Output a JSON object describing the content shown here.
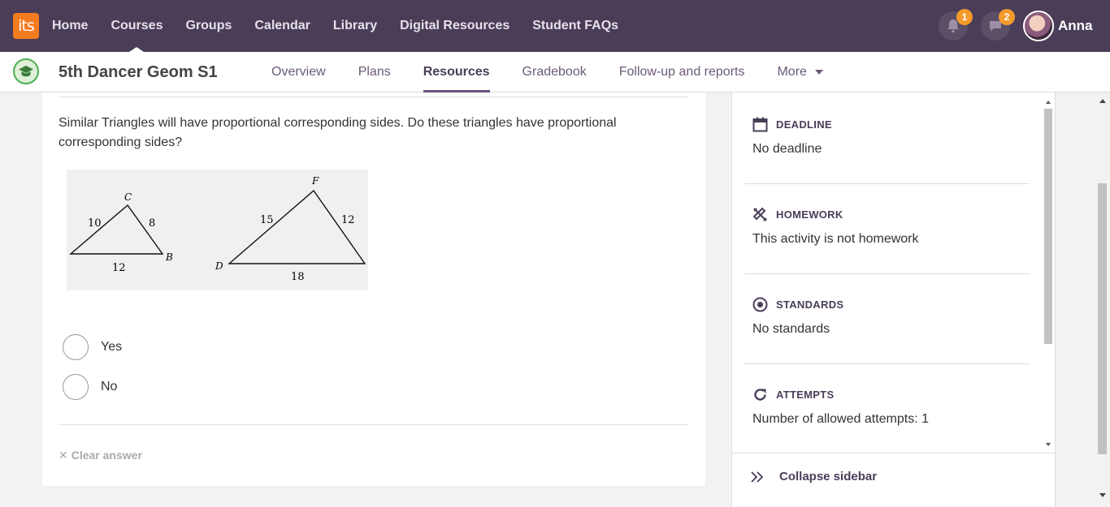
{
  "app": {
    "logo_text": "its"
  },
  "top_nav": {
    "items": [
      "Home",
      "Courses",
      "Groups",
      "Calendar",
      "Library",
      "Digital Resources",
      "Student FAQs"
    ],
    "notifications_count": "1",
    "messages_count": "2",
    "user_name": "Anna"
  },
  "course": {
    "title": "5th Dancer Geom S1",
    "tabs": [
      "Overview",
      "Plans",
      "Resources",
      "Gradebook",
      "Follow-up and reports",
      "More"
    ],
    "active_tab": "Resources"
  },
  "question": {
    "text": "Similar Triangles will have proportional corresponding sides.  Do these triangles have proportional corresponding sides?",
    "figure": {
      "triangle1": {
        "vertex_c": "C",
        "vertex_b": "B",
        "side_left": "10",
        "side_right": "8",
        "side_bottom": "12"
      },
      "triangle2": {
        "vertex_f": "F",
        "vertex_d": "D",
        "side_left": "15",
        "side_right": "12",
        "side_bottom": "18"
      }
    },
    "options": [
      "Yes",
      "No"
    ],
    "clear_label": "Clear answer"
  },
  "sidebar": {
    "deadline": {
      "title": "DEADLINE",
      "value": "No deadline"
    },
    "homework": {
      "title": "HOMEWORK",
      "value": "This activity is not homework"
    },
    "standards": {
      "title": "STANDARDS",
      "value": "No standards"
    },
    "attempts": {
      "title": "ATTEMPTS",
      "value": "Number of allowed attempts: 1"
    },
    "collapse_label": "Collapse sidebar"
  },
  "colors": {
    "topbar": "#4a3d58",
    "logo": "#f47b20",
    "badge": "#f39a2b",
    "accent": "#6b4f7c"
  }
}
